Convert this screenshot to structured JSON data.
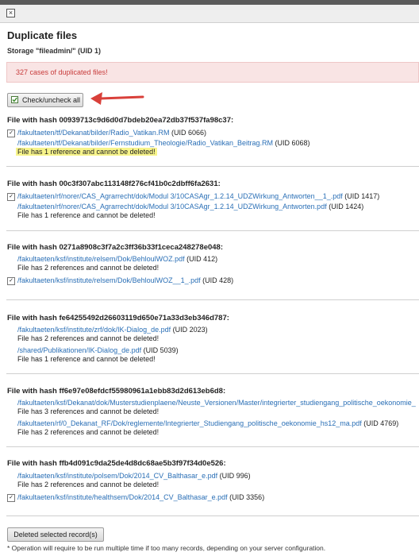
{
  "header": {
    "close_glyph": "×"
  },
  "page": {
    "title": "Duplicate files",
    "storage": "Storage \"fileadmin/\" (UID 1)",
    "alert": "327 cases of duplicated files!",
    "toggle_label": "Check/uncheck all"
  },
  "groups": [
    {
      "hash": "File with hash 00939713c9d6d0d7bdeb20ea72db37f537fa98c37:",
      "files": [
        {
          "checked": true,
          "path": "/fakultaeten/tf/Dekanat/bilder/Radio_Vatikan.RM",
          "uid": " (UID 6066)",
          "note": ""
        },
        {
          "checked": false,
          "path": "/fakultaeten/tf/Dekanat/bilder/Fernstudium_Theologie/Radio_Vatikan_Beitrag.RM",
          "uid": " (UID 6068)",
          "note": "File has 1 reference and cannot be deleted!"
        }
      ]
    },
    {
      "hash": "File with hash 00c3f307abc113148f276cf41b0c2dbff6fa2631:",
      "files": [
        {
          "checked": true,
          "path": "/fakultaeten/rf/norer/CAS_Agrarrecht/dok/Modul 3/10CASAgr_1.2.14_UDZWirkung_Antworten__1_.pdf",
          "uid": " (UID 1417)",
          "note": ""
        },
        {
          "checked": false,
          "path": "/fakultaeten/rf/norer/CAS_Agrarrecht/dok/Modul 3/10CASAgr_1.2.14_UDZWirkung_Antworten.pdf",
          "uid": " (UID 1424)",
          "note": "File has 1 reference and cannot be deleted!"
        }
      ]
    },
    {
      "hash": "File with hash 0271a8908c3f7a2c3ff36b33f1ceca248278e048:",
      "files": [
        {
          "checked": false,
          "path": "/fakultaeten/ksf/institute/relsem/Dok/BehloulWOZ.pdf",
          "uid": " (UID 412)",
          "note": "File has 2 references and cannot be deleted!"
        },
        {
          "checked": true,
          "path": "/fakultaeten/ksf/institute/relsem/Dok/BehloulWOZ__1_.pdf",
          "uid": " (UID 428)",
          "note": ""
        }
      ]
    },
    {
      "hash": "File with hash fe64255492d26603119d650e71a33d3eb346d787:",
      "files": [
        {
          "checked": false,
          "path": "/fakultaeten/ksf/institute/zrf/dok/IK-Dialog_de.pdf",
          "uid": " (UID 2023)",
          "note": "File has 2 references and cannot be deleted!"
        },
        {
          "checked": false,
          "path": "/shared/Publikationen/IK-Dialog_de.pdf",
          "uid": " (UID 5039)",
          "note": "File has 1 reference and cannot be deleted!"
        }
      ]
    },
    {
      "hash": "File with hash ff6e97e08efdcf55980961a1ebb83d2d613eb6d8:",
      "files": [
        {
          "checked": false,
          "path": "/fakultaeten/ksf/Dekanat/dok/Musterstudienplaene/Neuste_Versionen/Master/integrierter_studiengang_politische_oekonomie_",
          "uid": "",
          "note": "File has 3 references and cannot be deleted!"
        },
        {
          "checked": false,
          "path": "/fakultaeten/rf/0_Dekanat_RF/Dok/reglemente/Integrierter_Studiengang_politische_oekonomie_hs12_ma.pdf",
          "uid": " (UID 4769)",
          "note": "File has 2 references and cannot be deleted!"
        }
      ]
    },
    {
      "hash": "File with hash ffb4d091c9da25de4d8dc68ae5b3f97f34d0e526:",
      "files": [
        {
          "checked": false,
          "path": "/fakultaeten/ksf/institute/polsem/Dok/2014_CV_Balthasar_e.pdf",
          "uid": " (UID 996)",
          "note": "File has 2 references and cannot be deleted!"
        },
        {
          "checked": true,
          "path": "/fakultaeten/ksf/institute/healthsem/Dok/2014_CV_Balthasar_e.pdf",
          "uid": " (UID 3356)",
          "note": ""
        }
      ]
    }
  ],
  "footer": {
    "delete_label": "Deleted selected record(s)",
    "footnote": "* Operation will require to be run multiple time if too many records, depending on your server configuration."
  },
  "colors": {
    "link": "#2a6fb6",
    "alert_text": "#c83c3c",
    "alert_bg": "#f9e4e4",
    "highlight": "#f7f48a",
    "arrow": "#d9403a"
  }
}
